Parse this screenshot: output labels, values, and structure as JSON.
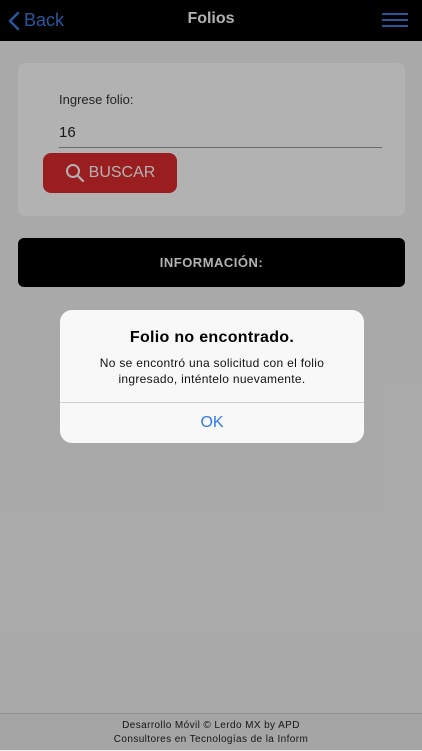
{
  "nav": {
    "back_label": "Back",
    "title": "Folios"
  },
  "search": {
    "field_label": "Ingrese folio:",
    "input_value": "16",
    "button_label": "BUSCAR"
  },
  "info": {
    "header": "INFORMACIÓN:"
  },
  "footer": {
    "line1": "Desarrollo Móvil © Lerdo MX by APD",
    "line2": "Consultores en Tecnologías de la Inform"
  },
  "alert": {
    "title": "Folio no encontrado.",
    "message": "No se encontró una solicitud con el folio ingresado, inténtelo nuevamente.",
    "ok_label": "OK"
  },
  "colors": {
    "accent_blue": "#3a7be0",
    "button_red": "#dd2a2e"
  },
  "icons": {
    "back": "chevron-left-icon",
    "menu": "hamburger-menu-icon",
    "search": "magnifier-icon"
  }
}
